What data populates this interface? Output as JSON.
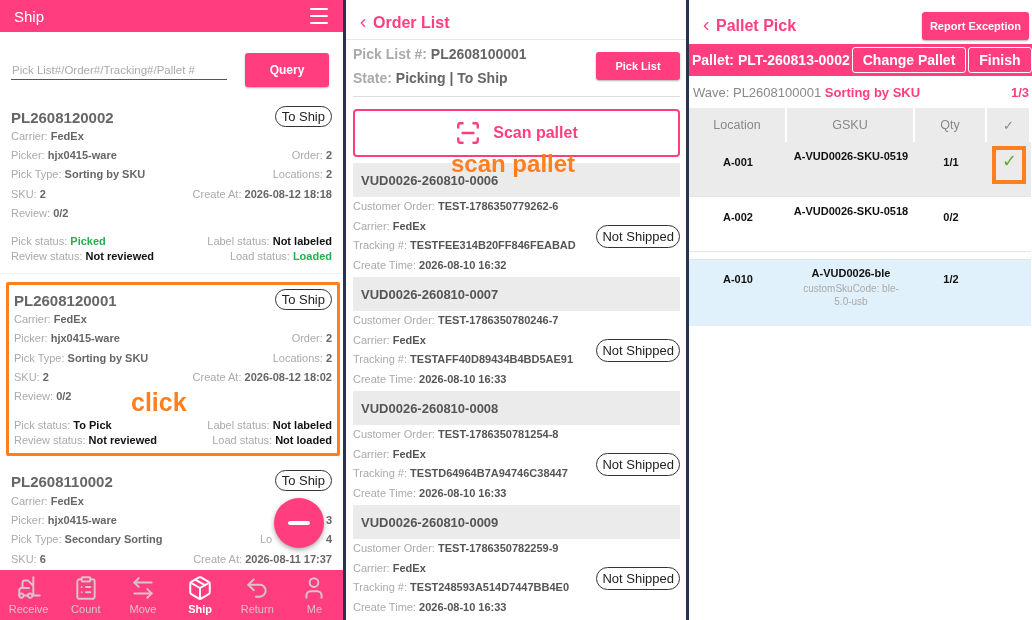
{
  "ship_panel": {
    "title": "Ship",
    "search": {
      "placeholder": "Pick List#/Order#/Tracking#/Pallet #"
    },
    "query_button": "Query",
    "cards": [
      {
        "id": "PL2608120002",
        "badge": "To Ship",
        "highlighted": false,
        "rows": [
          {
            "left": {
              "label": "Carrier:",
              "value": "FedEx"
            }
          },
          {
            "left": {
              "label": "Picker:",
              "value": "hjx0415-ware"
            },
            "right": {
              "label": "Order:",
              "value": "2"
            }
          },
          {
            "left": {
              "label": "Pick Type:",
              "value": "Sorting by SKU"
            },
            "right": {
              "label": "Locations:",
              "value": "2"
            }
          },
          {
            "left": {
              "label": "SKU:",
              "value": "2"
            },
            "right": {
              "label": "Create At:",
              "value": "2026-08-12 18:18"
            }
          },
          {
            "left": {
              "label": "Review:",
              "value": "0/2"
            }
          }
        ],
        "statuses": [
          {
            "left": {
              "label": "Pick status:",
              "value": "Picked",
              "done": true
            },
            "right": {
              "label": "Label status:",
              "value": "Not labeled",
              "done": false
            }
          },
          {
            "left": {
              "label": "Review status:",
              "value": "Not reviewed",
              "done": false
            },
            "right": {
              "label": "Load status:",
              "value": "Loaded",
              "done": true
            }
          }
        ]
      },
      {
        "id": "PL2608120001",
        "badge": "To Ship",
        "highlighted": true,
        "rows": [
          {
            "left": {
              "label": "Carrier:",
              "value": "FedEx"
            }
          },
          {
            "left": {
              "label": "Picker:",
              "value": "hjx0415-ware"
            },
            "right": {
              "label": "Order:",
              "value": "2"
            }
          },
          {
            "left": {
              "label": "Pick Type:",
              "value": "Sorting by SKU"
            },
            "right": {
              "label": "Locations:",
              "value": "2"
            }
          },
          {
            "left": {
              "label": "SKU:",
              "value": "2"
            },
            "right": {
              "label": "Create At:",
              "value": "2026-08-12 18:02"
            }
          },
          {
            "left": {
              "label": "Review:",
              "value": "0/2"
            }
          }
        ],
        "statuses": [
          {
            "left": {
              "label": "Pick status:",
              "value": "To Pick",
              "done": false
            },
            "right": {
              "label": "Label status:",
              "value": "Not labeled",
              "done": false
            }
          },
          {
            "left": {
              "label": "Review status:",
              "value": "Not reviewed",
              "done": false
            },
            "right": {
              "label": "Load status:",
              "value": "Not loaded",
              "done": false
            }
          }
        ]
      },
      {
        "id": "PL2608110002",
        "badge": "To Ship",
        "highlighted": false,
        "rows": [
          {
            "left": {
              "label": "Carrier:",
              "value": "FedEx"
            }
          },
          {
            "left": {
              "label": "Picker:",
              "value": "hjx0415-ware"
            },
            "right": {
              "kind": "covered",
              "value": "3"
            }
          },
          {
            "left": {
              "label": "Pick Type:",
              "value": "Secondary Sorting"
            },
            "right": {
              "kind": "covered",
              "label": "Lo",
              "value": "4"
            }
          },
          {
            "left": {
              "label": "SKU:",
              "value": "6"
            },
            "right": {
              "label": "Create At:",
              "value": "2026-08-11 17:37"
            }
          }
        ]
      }
    ],
    "annotation": "click",
    "tabs": [
      {
        "label": "Receive",
        "kind": "forklift",
        "selected": false
      },
      {
        "label": "Count",
        "kind": "clipboard",
        "selected": false
      },
      {
        "label": "Move",
        "kind": "move",
        "selected": false
      },
      {
        "label": "Ship",
        "kind": "box",
        "selected": true
      },
      {
        "label": "Return",
        "kind": "return",
        "selected": false
      },
      {
        "label": "Me",
        "kind": "user",
        "selected": false
      }
    ]
  },
  "order_panel": {
    "title": "Order List",
    "pick_list_label": "Pick List #:",
    "pick_list": "PL2608100001",
    "state_label": "State:",
    "state": "Picking | To Ship",
    "pick_list_button": "Pick List",
    "scan_button": "Scan pallet",
    "annotation": "scan pallet",
    "orders": [
      {
        "id": "VUD0026-260810-0006",
        "badge": "Not Shipped",
        "fields": [
          {
            "label": "Customer Order:",
            "value": "TEST-1786350779262-6"
          },
          {
            "label": "Carrier:",
            "value": "FedEx"
          },
          {
            "label": "Tracking #:",
            "value": "TESTFEE314B20FF846FEABAD"
          },
          {
            "label": "Create Time:",
            "value": "2026-08-10 16:32"
          }
        ]
      },
      {
        "id": "VUD0026-260810-0007",
        "badge": "Not Shipped",
        "fields": [
          {
            "label": "Customer Order:",
            "value": "TEST-1786350780246-7"
          },
          {
            "label": "Carrier:",
            "value": "FedEx"
          },
          {
            "label": "Tracking #:",
            "value": "TESTAFF40D89434B4BD5AE91"
          },
          {
            "label": "Create Time:",
            "value": "2026-08-10 16:33"
          }
        ]
      },
      {
        "id": "VUD0026-260810-0008",
        "badge": "Not Shipped",
        "fields": [
          {
            "label": "Customer Order:",
            "value": "TEST-1786350781254-8"
          },
          {
            "label": "Carrier:",
            "value": "FedEx"
          },
          {
            "label": "Tracking #:",
            "value": "TESTD64964B7A94746C38447"
          },
          {
            "label": "Create Time:",
            "value": "2026-08-10 16:33"
          }
        ]
      },
      {
        "id": "VUD0026-260810-0009",
        "badge": "Not Shipped",
        "fields": [
          {
            "label": "Customer Order:",
            "value": "TEST-1786350782259-9"
          },
          {
            "label": "Carrier:",
            "value": "FedEx"
          },
          {
            "label": "Tracking #:",
            "value": "TEST248593A514D7447BB4E0"
          },
          {
            "label": "Create Time:",
            "value": "2026-08-10 16:33"
          }
        ]
      }
    ]
  },
  "pallet_panel": {
    "title": "Pallet Pick",
    "report_button": "Report Exception",
    "pallet": "Pallet: PLT-260813-0002",
    "change_button": "Change Pallet",
    "finish_button": "Finish",
    "wave_label": "Wave: PL2608100001",
    "wave_type": "Sorting by SKU",
    "progress": "1/3",
    "columns": [
      "Location",
      "GSKU",
      "Qty",
      "✓"
    ],
    "rows": [
      {
        "location": "A-001",
        "gsku": "A-VUD0026-SKU-0519",
        "qty": "1/1",
        "checked": true,
        "check": "✓",
        "selected": false
      },
      {
        "location": "A-002",
        "gsku": "A-VUD0026-SKU-0518",
        "qty": "0/2",
        "checked": false,
        "selected": false
      },
      {
        "location": "A-010",
        "gsku": "A-VUD0026-ble",
        "sub": "customSkuCode: ble-5.0-usb",
        "qty": "1/2",
        "checked": false,
        "selected": true
      }
    ]
  }
}
